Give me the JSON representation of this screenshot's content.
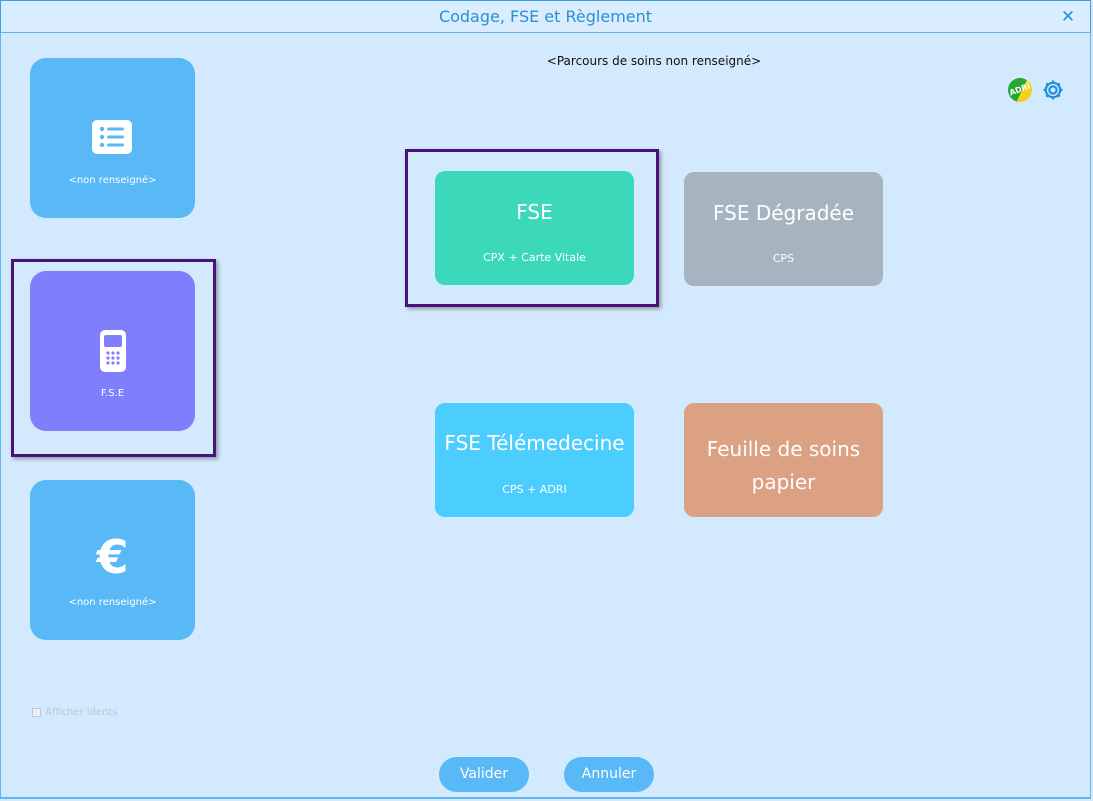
{
  "window": {
    "title": "Codage, FSE et Règlement"
  },
  "sidebar": {
    "tiles": [
      {
        "icon": "list-icon",
        "label": "<non renseigné>"
      },
      {
        "icon": "card-reader-icon",
        "label": "F.S.E"
      },
      {
        "icon": "euro-icon",
        "label": "<non renseigné>"
      }
    ]
  },
  "header": {
    "parcours": "<Parcours de soins non renseigné>",
    "adri_icon_text": "ADRi"
  },
  "options": [
    {
      "title": "FSE",
      "subtitle": "CPX + Carte Vitale",
      "color": "#3cd8ba",
      "selected": true
    },
    {
      "title": "FSE Dégradée",
      "subtitle": "CPS",
      "color": "#a6b4c0"
    },
    {
      "title": "FSE Télémedecine",
      "subtitle": "CPS + ADRI",
      "color": "#4bcdfd"
    },
    {
      "title": "Feuille de soins papier",
      "color": "#dca082"
    }
  ],
  "footer": {
    "afficher_idents": "Afficher idents",
    "afficher_idents_checked": false,
    "valider": "Valider",
    "annuler": "Annuler"
  },
  "colors": {
    "background": "#d3e9fd",
    "accent": "#59b8f6",
    "selected_tile": "#7f7ffe",
    "selection_frame": "#4a1178"
  }
}
